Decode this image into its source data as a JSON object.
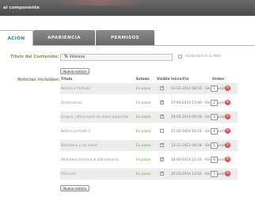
{
  "window": {
    "title": "al componente"
  },
  "tabs": [
    {
      "label": "ACIÓN",
      "active": true
    },
    {
      "label": "APARIENCIA",
      "active": false
    },
    {
      "label": "PERMISOS",
      "active": false
    }
  ],
  "form": {
    "title_label": "Título del Contenido:",
    "title_value": "Te interesa",
    "visibility_label": "Visibilidad en la Web",
    "visibility_checked": false,
    "news_label": "Noticias incluidas:",
    "add_button_label": "Nueva noticia"
  },
  "table": {
    "columns": [
      "Título",
      "Estado",
      "Visible",
      "Inicio/Fin",
      "Orden"
    ],
    "rows": [
      {
        "title": "Noticia 2 Portada",
        "estado": "En plazo",
        "visible": true,
        "fechas": "03-02-2014 08:59 - Sin caducidad",
        "orden": "1"
      },
      {
        "title": "Destacamos",
        "estado": "En plazo",
        "visible": true,
        "fechas": "07-03-2014 13:40 - Sin caducidad",
        "orden": "2"
      },
      {
        "title": "Scopus, última base de datos adquirida",
        "estado": "En plazo",
        "visible": true,
        "fechas": "24-03-2014 09:28 - Sin caducidad",
        "orden": "3"
      },
      {
        "title": "Noticia portada 1",
        "estado": "En plazo",
        "visible": false,
        "fechas": "21-02-2014 14:21 - Sin caducidad",
        "orden": "4"
      },
      {
        "title": "Biblioteca y sociedad",
        "estado": "En plazo",
        "visible": true,
        "fechas": "13-11-2013 09:24 - Sin caducidad",
        "orden": "5"
      },
      {
        "title": "Biblioteca Informa al bibliotecario",
        "estado": "En plazo",
        "visible": true,
        "fechas": "18-03-2014 21:41 - Sin caducidad",
        "orden": "6"
      },
      {
        "title": "RSS ucm",
        "estado": "En plazo",
        "visible": true,
        "fechas": "25-03-2014 13:52 - Sin caducidad",
        "orden": "7"
      }
    ]
  },
  "icons": {
    "delete": "delete-circle-icon",
    "check": "checkmark-icon"
  },
  "colors": {
    "active_tab_text": "#1f7fbf",
    "label_olive": "#8e8e50",
    "status_green": "#6aa84f",
    "delete_red": "#e05050",
    "titlebar": "#555555"
  }
}
